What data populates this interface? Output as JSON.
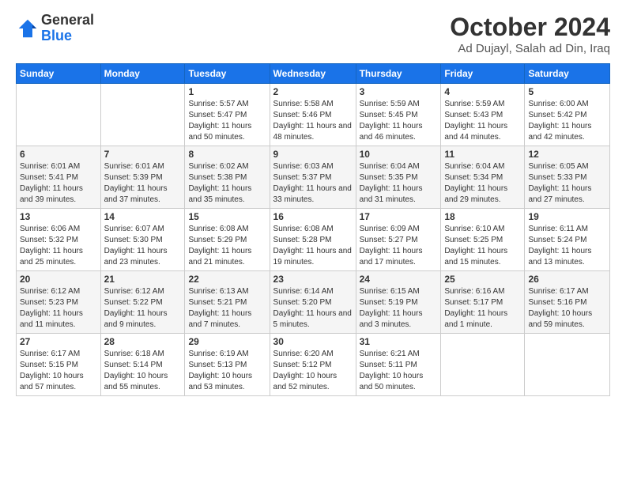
{
  "header": {
    "logo_line1": "General",
    "logo_line2": "Blue",
    "title": "October 2024",
    "subtitle": "Ad Dujayl, Salah ad Din, Iraq"
  },
  "days_of_week": [
    "Sunday",
    "Monday",
    "Tuesday",
    "Wednesday",
    "Thursday",
    "Friday",
    "Saturday"
  ],
  "weeks": [
    [
      {
        "num": "",
        "info": ""
      },
      {
        "num": "",
        "info": ""
      },
      {
        "num": "1",
        "info": "Sunrise: 5:57 AM\nSunset: 5:47 PM\nDaylight: 11 hours and 50 minutes."
      },
      {
        "num": "2",
        "info": "Sunrise: 5:58 AM\nSunset: 5:46 PM\nDaylight: 11 hours and 48 minutes."
      },
      {
        "num": "3",
        "info": "Sunrise: 5:59 AM\nSunset: 5:45 PM\nDaylight: 11 hours and 46 minutes."
      },
      {
        "num": "4",
        "info": "Sunrise: 5:59 AM\nSunset: 5:43 PM\nDaylight: 11 hours and 44 minutes."
      },
      {
        "num": "5",
        "info": "Sunrise: 6:00 AM\nSunset: 5:42 PM\nDaylight: 11 hours and 42 minutes."
      }
    ],
    [
      {
        "num": "6",
        "info": "Sunrise: 6:01 AM\nSunset: 5:41 PM\nDaylight: 11 hours and 39 minutes."
      },
      {
        "num": "7",
        "info": "Sunrise: 6:01 AM\nSunset: 5:39 PM\nDaylight: 11 hours and 37 minutes."
      },
      {
        "num": "8",
        "info": "Sunrise: 6:02 AM\nSunset: 5:38 PM\nDaylight: 11 hours and 35 minutes."
      },
      {
        "num": "9",
        "info": "Sunrise: 6:03 AM\nSunset: 5:37 PM\nDaylight: 11 hours and 33 minutes."
      },
      {
        "num": "10",
        "info": "Sunrise: 6:04 AM\nSunset: 5:35 PM\nDaylight: 11 hours and 31 minutes."
      },
      {
        "num": "11",
        "info": "Sunrise: 6:04 AM\nSunset: 5:34 PM\nDaylight: 11 hours and 29 minutes."
      },
      {
        "num": "12",
        "info": "Sunrise: 6:05 AM\nSunset: 5:33 PM\nDaylight: 11 hours and 27 minutes."
      }
    ],
    [
      {
        "num": "13",
        "info": "Sunrise: 6:06 AM\nSunset: 5:32 PM\nDaylight: 11 hours and 25 minutes."
      },
      {
        "num": "14",
        "info": "Sunrise: 6:07 AM\nSunset: 5:30 PM\nDaylight: 11 hours and 23 minutes."
      },
      {
        "num": "15",
        "info": "Sunrise: 6:08 AM\nSunset: 5:29 PM\nDaylight: 11 hours and 21 minutes."
      },
      {
        "num": "16",
        "info": "Sunrise: 6:08 AM\nSunset: 5:28 PM\nDaylight: 11 hours and 19 minutes."
      },
      {
        "num": "17",
        "info": "Sunrise: 6:09 AM\nSunset: 5:27 PM\nDaylight: 11 hours and 17 minutes."
      },
      {
        "num": "18",
        "info": "Sunrise: 6:10 AM\nSunset: 5:25 PM\nDaylight: 11 hours and 15 minutes."
      },
      {
        "num": "19",
        "info": "Sunrise: 6:11 AM\nSunset: 5:24 PM\nDaylight: 11 hours and 13 minutes."
      }
    ],
    [
      {
        "num": "20",
        "info": "Sunrise: 6:12 AM\nSunset: 5:23 PM\nDaylight: 11 hours and 11 minutes."
      },
      {
        "num": "21",
        "info": "Sunrise: 6:12 AM\nSunset: 5:22 PM\nDaylight: 11 hours and 9 minutes."
      },
      {
        "num": "22",
        "info": "Sunrise: 6:13 AM\nSunset: 5:21 PM\nDaylight: 11 hours and 7 minutes."
      },
      {
        "num": "23",
        "info": "Sunrise: 6:14 AM\nSunset: 5:20 PM\nDaylight: 11 hours and 5 minutes."
      },
      {
        "num": "24",
        "info": "Sunrise: 6:15 AM\nSunset: 5:19 PM\nDaylight: 11 hours and 3 minutes."
      },
      {
        "num": "25",
        "info": "Sunrise: 6:16 AM\nSunset: 5:17 PM\nDaylight: 11 hours and 1 minute."
      },
      {
        "num": "26",
        "info": "Sunrise: 6:17 AM\nSunset: 5:16 PM\nDaylight: 10 hours and 59 minutes."
      }
    ],
    [
      {
        "num": "27",
        "info": "Sunrise: 6:17 AM\nSunset: 5:15 PM\nDaylight: 10 hours and 57 minutes."
      },
      {
        "num": "28",
        "info": "Sunrise: 6:18 AM\nSunset: 5:14 PM\nDaylight: 10 hours and 55 minutes."
      },
      {
        "num": "29",
        "info": "Sunrise: 6:19 AM\nSunset: 5:13 PM\nDaylight: 10 hours and 53 minutes."
      },
      {
        "num": "30",
        "info": "Sunrise: 6:20 AM\nSunset: 5:12 PM\nDaylight: 10 hours and 52 minutes."
      },
      {
        "num": "31",
        "info": "Sunrise: 6:21 AM\nSunset: 5:11 PM\nDaylight: 10 hours and 50 minutes."
      },
      {
        "num": "",
        "info": ""
      },
      {
        "num": "",
        "info": ""
      }
    ]
  ]
}
